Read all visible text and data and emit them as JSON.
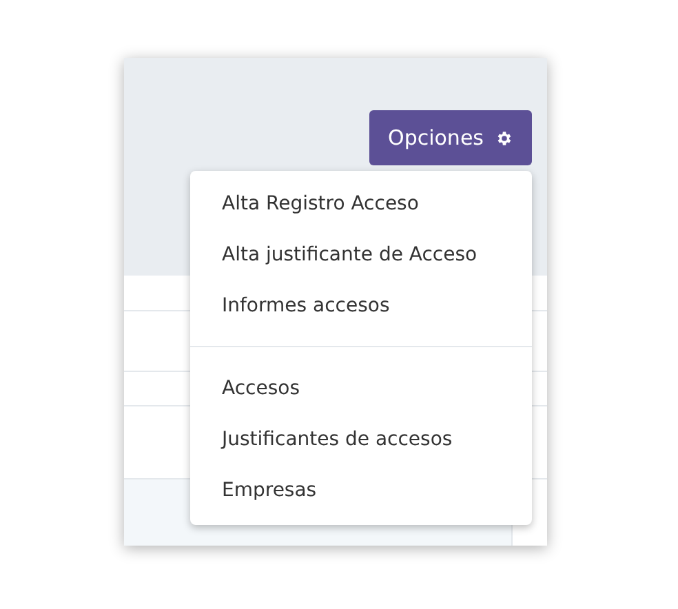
{
  "options_button": {
    "label": "Opciones"
  },
  "menu": {
    "sections": [
      {
        "items": [
          "Alta Registro Acceso",
          "Alta justificante de Acceso",
          "Informes accesos"
        ]
      },
      {
        "items": [
          "Accesos",
          "Justificantes de accesos",
          "Empresas"
        ]
      }
    ]
  }
}
